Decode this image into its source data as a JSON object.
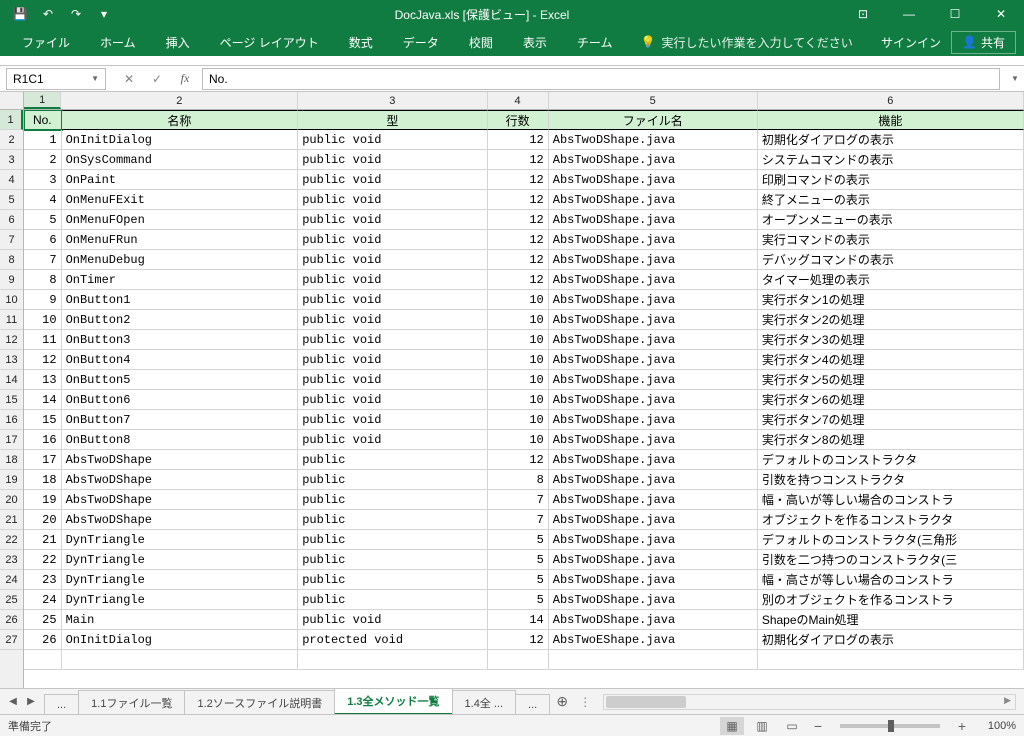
{
  "title": "DocJava.xls  [保護ビュー] - Excel",
  "qat": {
    "save": "💾",
    "undo": "↶",
    "redo": "↷",
    "customize": "▾"
  },
  "win": {
    "opts": "⊡",
    "min": "—",
    "max": "☐",
    "close": "✕"
  },
  "tabs": [
    "ファイル",
    "ホーム",
    "挿入",
    "ページ レイアウト",
    "数式",
    "データ",
    "校閲",
    "表示",
    "チーム"
  ],
  "tellme_placeholder": "実行したい作業を入力してください",
  "signin": "サインイン",
  "share": "共有",
  "name_box": "R1C1",
  "formula": "No.",
  "col_headers": [
    "1",
    "2",
    "3",
    "4",
    "5",
    "6"
  ],
  "row_headers": [
    "1",
    "2",
    "3",
    "4",
    "5",
    "6",
    "7",
    "8",
    "9",
    "10",
    "11",
    "12",
    "13",
    "14",
    "15",
    "16",
    "17",
    "18",
    "19",
    "20",
    "21",
    "22",
    "23",
    "24",
    "25",
    "26",
    "27"
  ],
  "headers": [
    "No.",
    "名称",
    "型",
    "行数",
    "ファイル名",
    "機能"
  ],
  "rows": [
    [
      "1",
      "OnInitDialog",
      "public void",
      "12",
      "AbsTwoDShape.java",
      "初期化ダイアログの表示"
    ],
    [
      "2",
      "OnSysCommand",
      "public void",
      "12",
      "AbsTwoDShape.java",
      "システムコマンドの表示"
    ],
    [
      "3",
      "OnPaint",
      "public void",
      "12",
      "AbsTwoDShape.java",
      "印刷コマンドの表示"
    ],
    [
      "4",
      "OnMenuFExit",
      "public void",
      "12",
      "AbsTwoDShape.java",
      "終了メニューの表示"
    ],
    [
      "5",
      "OnMenuFOpen",
      "public void",
      "12",
      "AbsTwoDShape.java",
      "オープンメニューの表示"
    ],
    [
      "6",
      "OnMenuFRun",
      "public void",
      "12",
      "AbsTwoDShape.java",
      "実行コマンドの表示"
    ],
    [
      "7",
      "OnMenuDebug",
      "public void",
      "12",
      "AbsTwoDShape.java",
      "デバッグコマンドの表示"
    ],
    [
      "8",
      "OnTimer",
      "public void",
      "12",
      "AbsTwoDShape.java",
      "タイマー処理の表示"
    ],
    [
      "9",
      "OnButton1",
      "public void",
      "10",
      "AbsTwoDShape.java",
      "実行ボタン1の処理"
    ],
    [
      "10",
      "OnButton2",
      "public void",
      "10",
      "AbsTwoDShape.java",
      "実行ボタン2の処理"
    ],
    [
      "11",
      "OnButton3",
      "public void",
      "10",
      "AbsTwoDShape.java",
      "実行ボタン3の処理"
    ],
    [
      "12",
      "OnButton4",
      "public void",
      "10",
      "AbsTwoDShape.java",
      "実行ボタン4の処理"
    ],
    [
      "13",
      "OnButton5",
      "public void",
      "10",
      "AbsTwoDShape.java",
      "実行ボタン5の処理"
    ],
    [
      "14",
      "OnButton6",
      "public void",
      "10",
      "AbsTwoDShape.java",
      "実行ボタン6の処理"
    ],
    [
      "15",
      "OnButton7",
      "public void",
      "10",
      "AbsTwoDShape.java",
      "実行ボタン7の処理"
    ],
    [
      "16",
      "OnButton8",
      "public void",
      "10",
      "AbsTwoDShape.java",
      "実行ボタン8の処理"
    ],
    [
      "17",
      "AbsTwoDShape",
      "public",
      "12",
      "AbsTwoDShape.java",
      "デフォルトのコンストラクタ"
    ],
    [
      "18",
      "AbsTwoDShape",
      "public",
      "8",
      "AbsTwoDShape.java",
      "引数を持つコンストラクタ"
    ],
    [
      "19",
      "AbsTwoDShape",
      "public",
      "7",
      "AbsTwoDShape.java",
      "幅・高いが等しい場合のコンストラ"
    ],
    [
      "20",
      "AbsTwoDShape",
      "public",
      "7",
      "AbsTwoDShape.java",
      "オブジェクトを作るコンストラクタ"
    ],
    [
      "21",
      "DynTriangle",
      "public",
      "5",
      "AbsTwoDShape.java",
      "デフォルトのコンストラクタ(三角形"
    ],
    [
      "22",
      "DynTriangle",
      "public",
      "5",
      "AbsTwoDShape.java",
      "引数を二つ持つのコンストラクタ(三"
    ],
    [
      "23",
      "DynTriangle",
      "public",
      "5",
      "AbsTwoDShape.java",
      "幅・高さが等しい場合のコンストラ"
    ],
    [
      "24",
      "DynTriangle",
      "public",
      "5",
      "AbsTwoDShape.java",
      "別のオブジェクトを作るコンストラ"
    ],
    [
      "25",
      "Main",
      "public void",
      "14",
      "AbsTwoDShape.java",
      "ShapeのMain処理"
    ],
    [
      "26",
      "OnInitDialog",
      "protected void",
      "12",
      "AbsTwoEShape.java",
      "初期化ダイアログの表示"
    ]
  ],
  "sheet_tabs": [
    "...",
    "1.1ファイル一覧",
    "1.2ソースファイル説明書",
    "1.3全メソッド一覧",
    "1.4全 ...",
    "..."
  ],
  "active_sheet": 3,
  "status": "準備完了",
  "zoom": "100%"
}
